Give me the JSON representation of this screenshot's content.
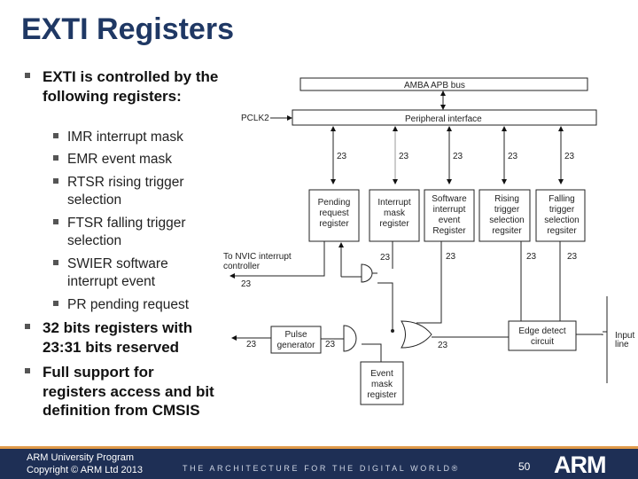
{
  "title": "EXTI Registers",
  "bullets": [
    {
      "text": "EXTI is controlled by the following registers:"
    },
    {
      "text": "32 bits registers with 23:31 bits reserved"
    },
    {
      "text": "Full support for registers access and bit definition from CMSIS"
    }
  ],
  "sub_bullets": [
    "IMR interrupt mask",
    "EMR event mask",
    "RTSR rising trigger selection",
    "FTSR falling trigger selection",
    "SWIER software interrupt event",
    "PR pending request"
  ],
  "diagram": {
    "bus": "AMBA APB bus",
    "clock": "PCLK2",
    "interface": "Peripheral interface",
    "width": "23",
    "registers": [
      [
        "Pending",
        "request",
        "register"
      ],
      [
        "Interrupt",
        "mask",
        "register"
      ],
      [
        "Software",
        "interrupt",
        "event",
        "Register"
      ],
      [
        "Rising",
        "trigger",
        "selection",
        "regsiter"
      ],
      [
        "Falling",
        "trigger",
        "selection",
        "regsiter"
      ]
    ],
    "nvic": [
      "To NVIC interrupt",
      "controller"
    ],
    "pulse": [
      "Pulse",
      "generator"
    ],
    "edge": [
      "Edge detect",
      "circuit"
    ],
    "event_mask": [
      "Event",
      "mask",
      "register"
    ],
    "input": [
      "Input",
      "line"
    ]
  },
  "footer": {
    "program": "ARM University Program",
    "copyright": "Copyright © ARM Ltd 2013",
    "tagline": "THE ARCHITECTURE FOR THE DIGITAL WORLD®",
    "page": "50",
    "logo": "ARM"
  }
}
